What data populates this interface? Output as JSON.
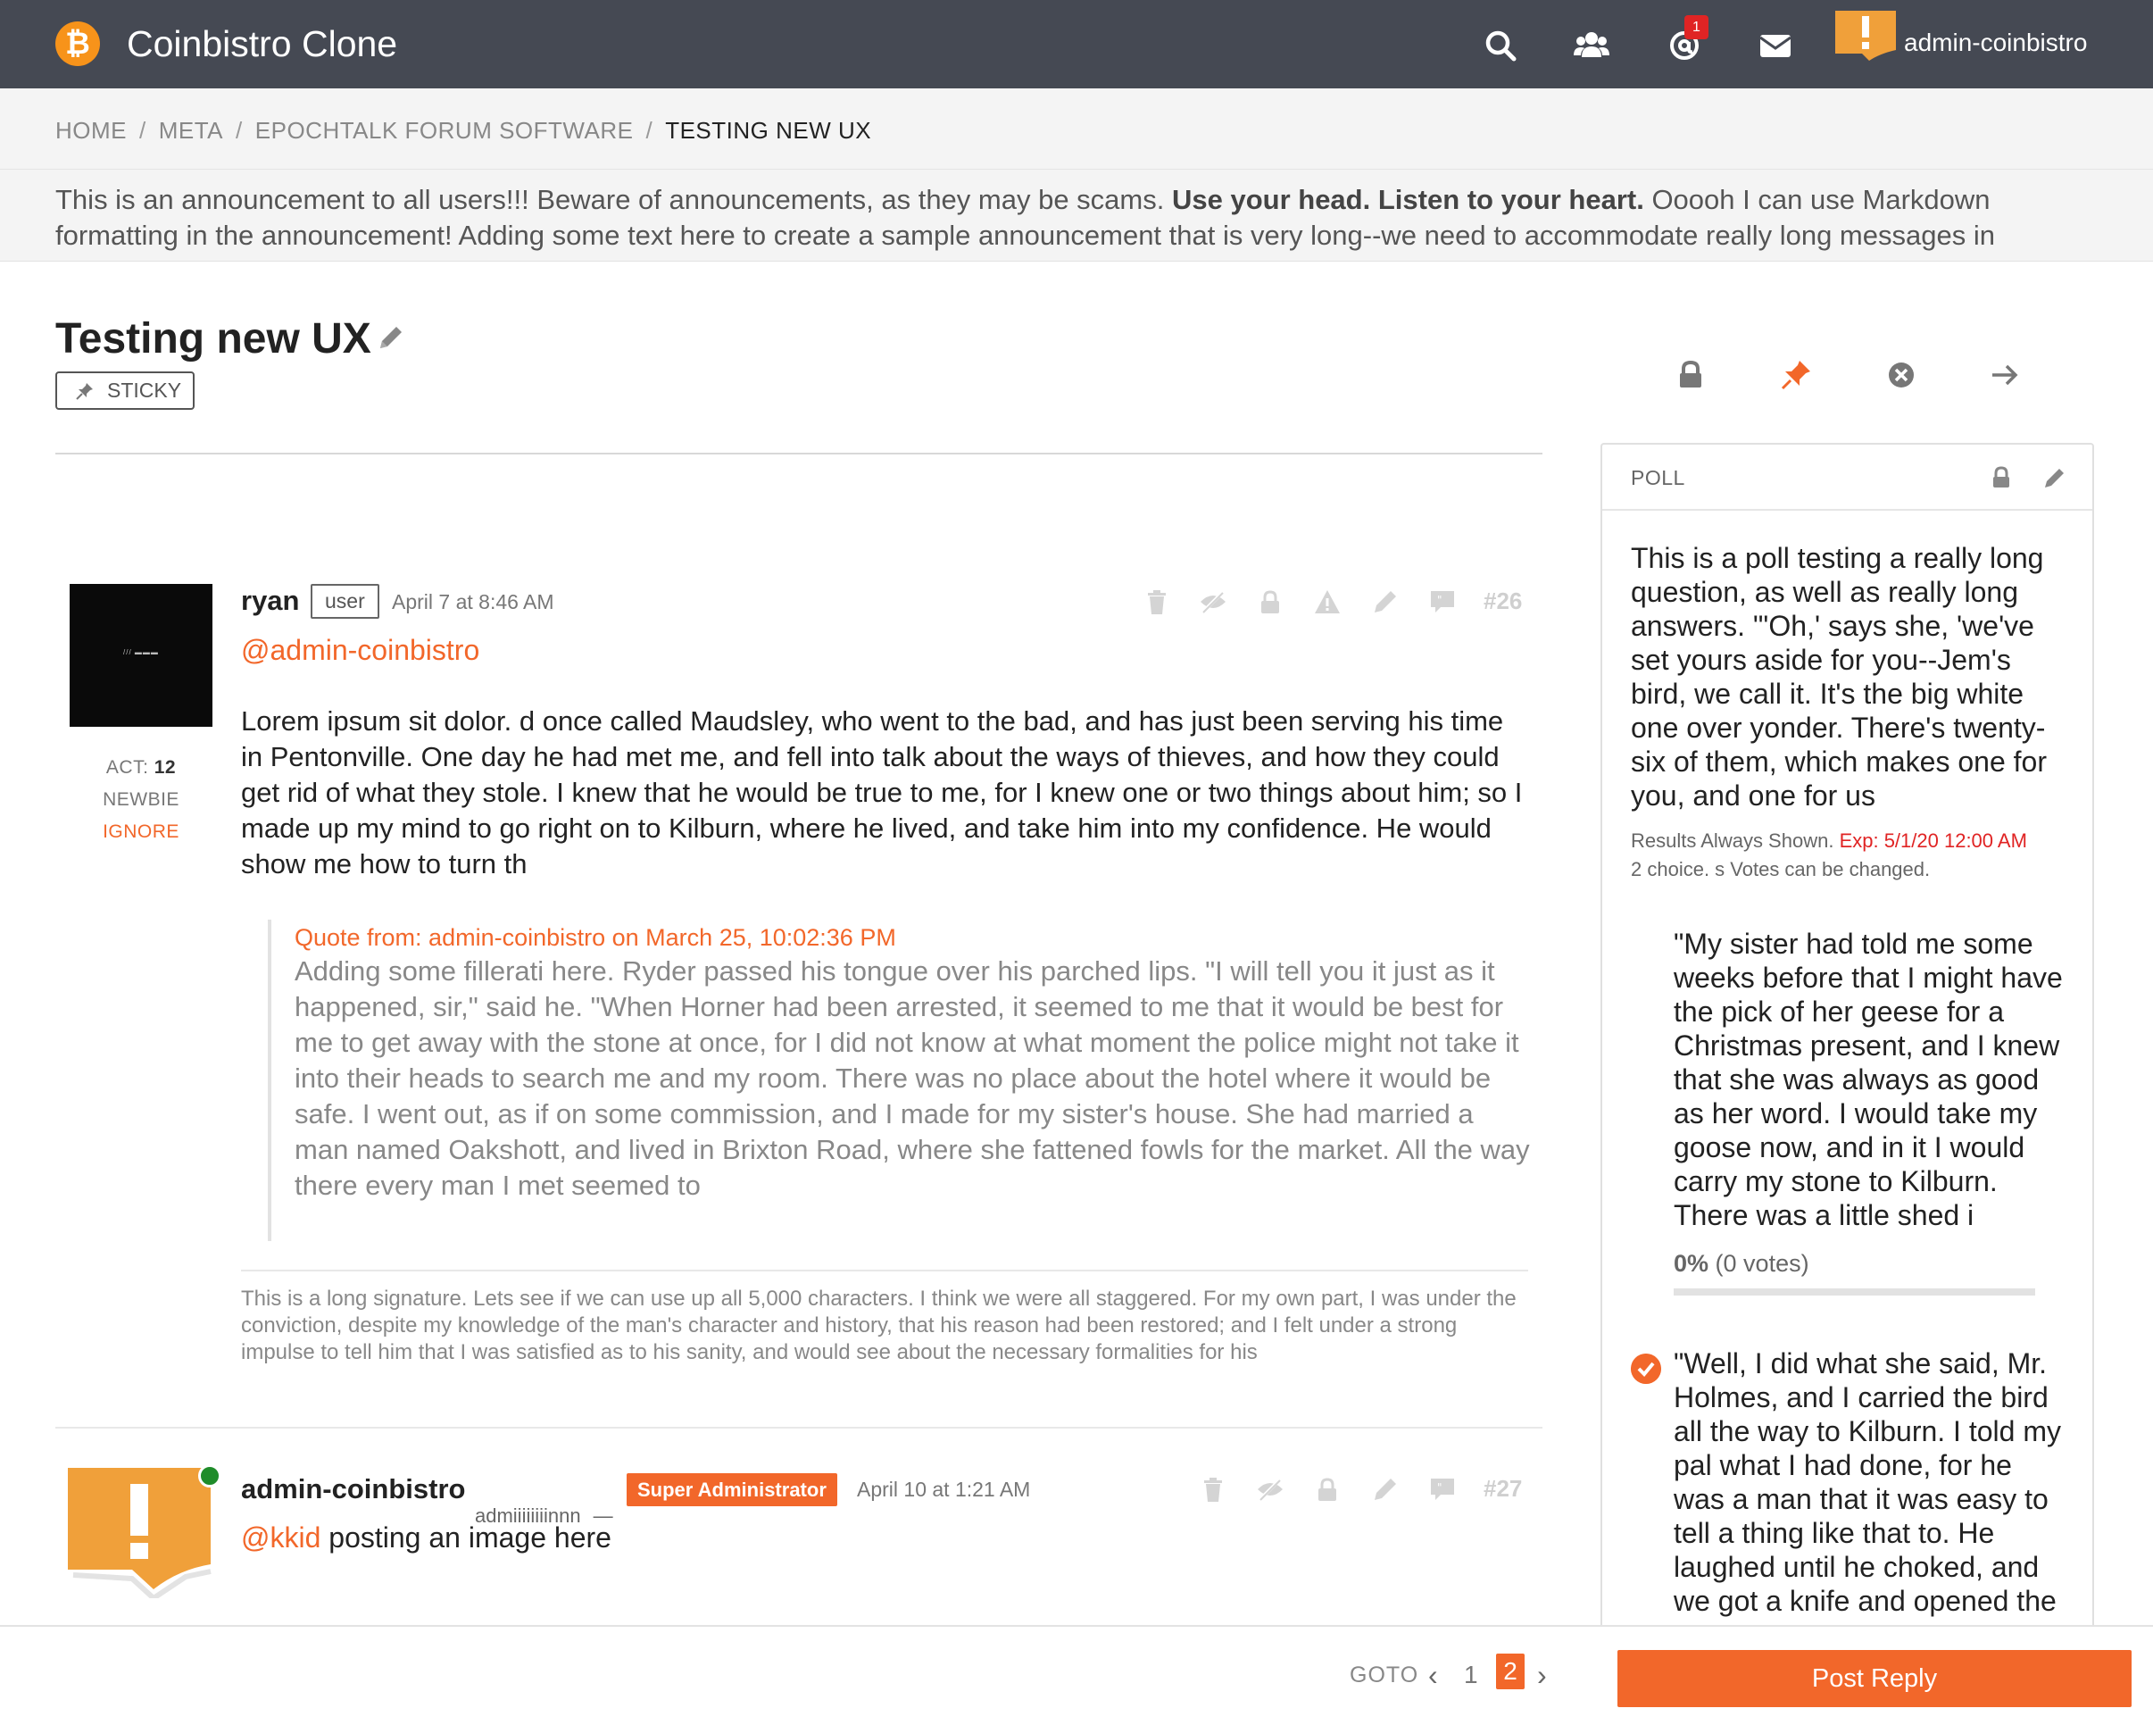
{
  "header": {
    "logo_glyph": "₿",
    "brand": "Coinbistro Clone",
    "notification_count": "1",
    "username": "admin-coinbistro",
    "icons": [
      "search-icon",
      "users-icon",
      "mentions-icon",
      "envelope-icon"
    ],
    "background_color": "#454953"
  },
  "breadcrumb": {
    "items": [
      "HOME",
      "META",
      "EPOCHTALK FORUM SOFTWARE"
    ],
    "current": "TESTING NEW UX",
    "separator": "/"
  },
  "announcement": {
    "text_start": "This is an announcement to all users!!! Beware of announcements, as they may be scams. ",
    "bold": "Use your head. Listen to your heart.",
    "text_end": " Ooooh I can use Markdown formatting in the announcement! Adding some text here to create a sample announcement that is very long--we need to accommodate really long messages in"
  },
  "thread": {
    "title": "Testing new UX",
    "sticky_label": "STICKY",
    "mod_icons": [
      "lock-icon",
      "pin-icon",
      "close-circle-icon",
      "move-arrow-icon"
    ]
  },
  "poll": {
    "label": "POLL",
    "question": "This is a poll testing a really long question, as well as really long answers. \"'Oh,' says she, 'we've set yours aside for you--Jem's bird, we call it. It's the big white one over yonder. There's twenty-six of them, which makes one for you, and one for us",
    "results_text": "Results Always Shown.",
    "expiry": "Exp: 5/1/20 12:00 AM",
    "choice_text": "2 choice. s Votes can be changed.",
    "answers": [
      {
        "text": "\"My sister had told me some weeks before that I might have the pick of her geese for a Christmas present, and I knew that she was always as good as her word. I would take my goose now, and in it I would carry my stone to Kilburn. There was a little shed i",
        "percent_label": "0%",
        "votes_label": "(0 votes)",
        "fraction": 0
      },
      {
        "text": "\"Well, I did what she said, Mr. Holmes, and I carried the bird all the way to Kilburn. I told my pal what I had done, for he was a man that it was easy to tell a thing like that to. He laughed until he choked, and we got a knife and opened the",
        "selected": true
      }
    ]
  },
  "posts": [
    {
      "author": "ryan",
      "role": "user",
      "date": "April 7 at 8:46 AM",
      "number": "#26",
      "activity_label": "ACT:",
      "activity_value": "12",
      "rank": "NEWBIE",
      "ignore_label": "IGNORE",
      "mention": "@admin-coinbistro",
      "body": "Lorem ipsum sit dolor. d once called Maudsley, who went to the bad, and has just been serving his time in Pentonville. One day he had met me, and fell into talk about the ways of thieves, and how they could get rid of what they stole. I knew that he would be true to me, for I knew one or two things about him; so I made up my mind to go right on to Kilburn, where he lived, and take him into my confidence. He would show me how to turn th",
      "quote_header": "Quote from: admin-coinbistro on March 25, 10:02:36 PM",
      "quote_body": "Adding some fillerati here. Ryder passed his tongue over his parched lips. \"I will tell you it just as it happened, sir,\" said he. \"When Horner had been arrested, it seemed to me that it would be best for me to get away with the stone at once, for I did not know at what moment the police might not take it into their heads to search me and my room. There was no place about the hotel where it would be safe. I went out, as if on some commission, and I made for my sister's house. She had married a man named Oakshott, and lived in Brixton Road, where she fattened fowls for the market. All the way there every man I met seemed to",
      "signature": "This is a long signature. Lets see if we can use up all 5,000 characters. I think we were all staggered. For my own part, I was under the conviction, despite my knowledge of the man's character and history, that his reason had been restored; and I felt under a strong impulse to tell him that I was satisfied as to his sanity, and would see about the necessary formalities for his",
      "actions": [
        "trash-icon",
        "hide-icon",
        "lock-icon",
        "report-icon",
        "edit-icon",
        "quote-icon"
      ]
    },
    {
      "author": "admin-coinbistro",
      "title": "admiiiiiiiinnn",
      "dash": "—",
      "role_badge": "Super Administrator",
      "date": "April 10 at 1:21 AM",
      "number": "#27",
      "mention": "@kkid",
      "body": " posting an image here",
      "actions": [
        "trash-icon",
        "hide-icon",
        "lock-icon",
        "edit-icon",
        "quote-icon"
      ]
    }
  ],
  "footer": {
    "goto": "GOTO",
    "pages": [
      "1",
      "2"
    ],
    "current_page": "2",
    "prev": "‹",
    "next": "›",
    "reply_label": "Post Reply",
    "accent_color": "#f2672a"
  }
}
